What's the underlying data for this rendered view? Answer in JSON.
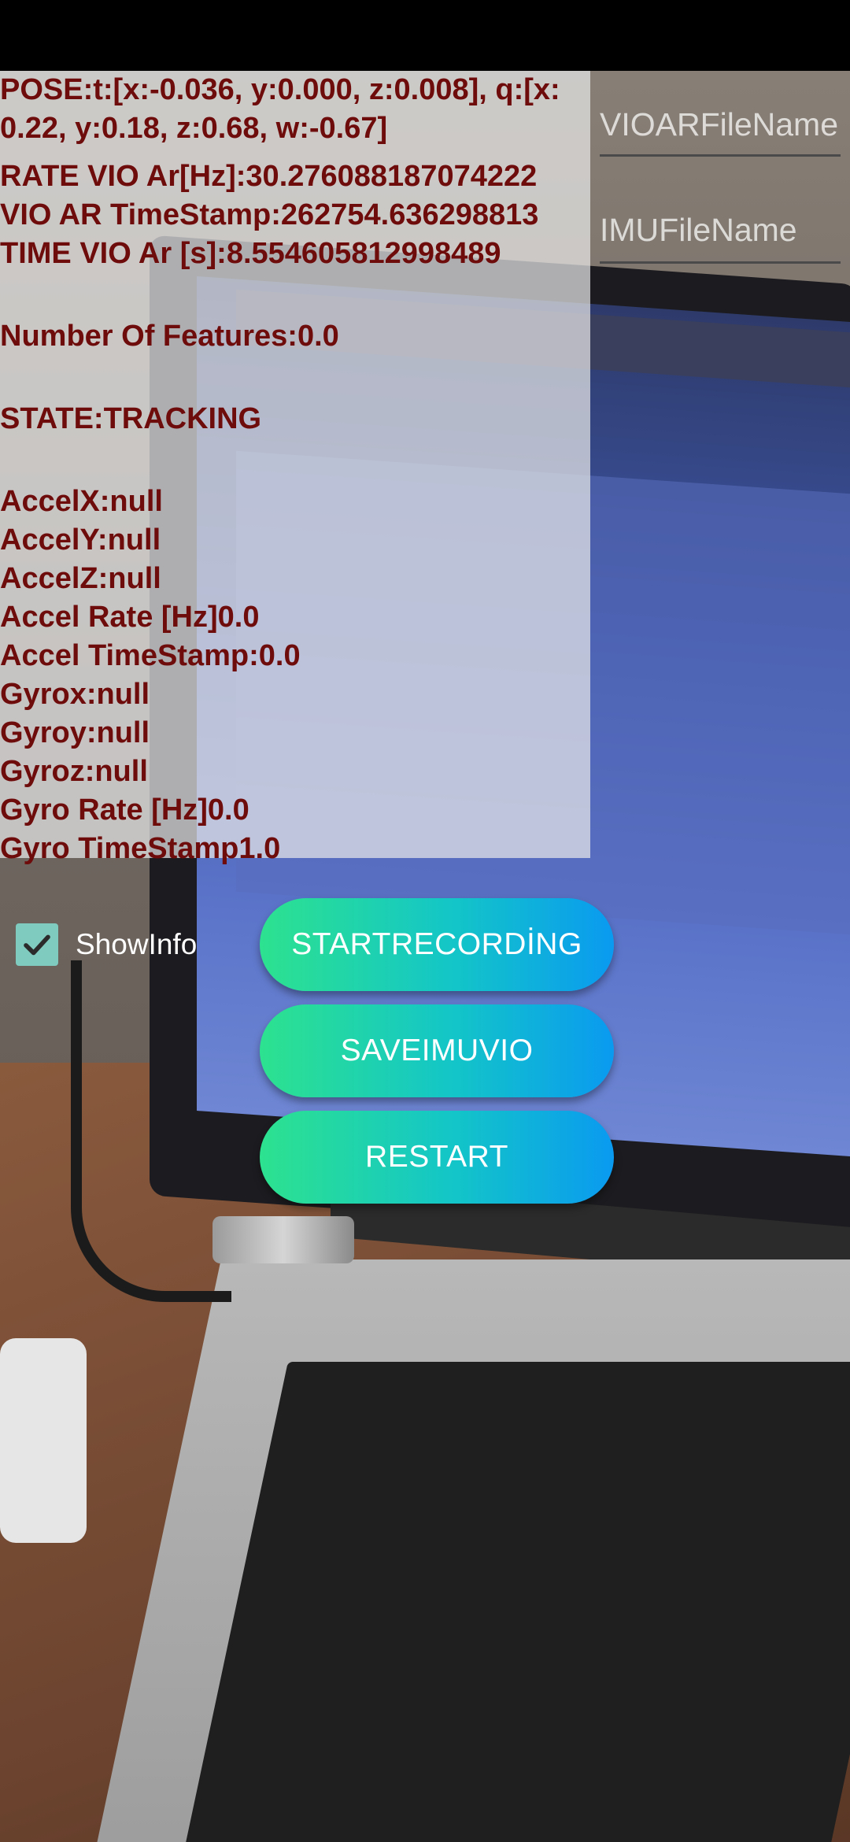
{
  "info": {
    "pose": "POSE:t:[x:-0.036, y:0.000, z:0.008], q:[x:\n0.22, y:0.18, z:0.68, w:-0.67]",
    "rate_vio": "RATE VIO Ar[Hz]:30.276088187074222",
    "vio_timestamp": "VIO AR TimeStamp:262754.636298813",
    "time_vio": "TIME VIO Ar [s]:8.554605812998489",
    "features": "Number Of Features:0.0",
    "state": "STATE:TRACKING",
    "accel_x": "AccelX:null",
    "accel_y": "AccelY:null",
    "accel_z": "AccelZ:null",
    "accel_rate": "Accel Rate [Hz]0.0",
    "accel_timestamp": "Accel TimeStamp:0.0",
    "gyro_x": "Gyrox:null",
    "gyro_y": "Gyroy:null",
    "gyro_z": "Gyroz:null",
    "gyro_rate": "Gyro Rate [Hz]0.0",
    "gyro_timestamp": "Gyro TimeStamp1.0"
  },
  "inputs": {
    "vioar_placeholder": "VIOARFileName",
    "vioar_value": "",
    "imu_placeholder": "IMUFileName",
    "imu_value": ""
  },
  "show_info": {
    "label": "ShowInfo",
    "checked": true
  },
  "buttons": {
    "start_recording": "STARTRECORDİNG",
    "save": "SAVEIMUVIO",
    "restart": "RESTART"
  },
  "colors": {
    "info_text": "#6e0b0b",
    "button_gradient_start": "#2de28f",
    "button_gradient_end": "#0a9af0",
    "checkbox": "#7fcbc0"
  },
  "icons": {
    "checkbox_check": "check-icon"
  }
}
